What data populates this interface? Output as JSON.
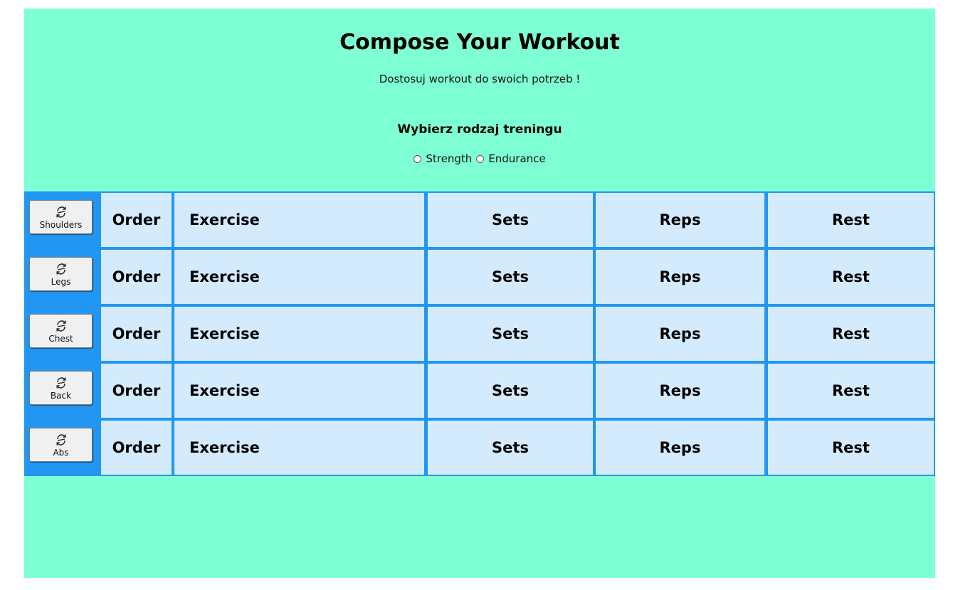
{
  "header": {
    "title": "Compose Your Workout",
    "subtitle": "Dostosuj workout do swoich potrzeb !"
  },
  "training_type": {
    "heading": "Wybierz rodzaj treningu",
    "options": [
      {
        "label": "Strength",
        "selected": false
      },
      {
        "label": "Endurance",
        "selected": false
      }
    ]
  },
  "workout": {
    "columns": {
      "order": "Order",
      "exercise": "Exercise",
      "sets": "Sets",
      "reps": "Reps",
      "rest": "Rest"
    },
    "groups": [
      {
        "label": "Shoulders",
        "icon": "swap-icon"
      },
      {
        "label": "Legs",
        "icon": "swap-icon"
      },
      {
        "label": "Chest",
        "icon": "swap-icon"
      },
      {
        "label": "Back",
        "icon": "swap-icon"
      },
      {
        "label": "Abs",
        "icon": "swap-icon"
      }
    ]
  },
  "colors": {
    "page_background": "#7fffd4",
    "table_border": "#2196f3",
    "cell_background": "#d4eafd",
    "button_background": "#f0f0f0"
  }
}
